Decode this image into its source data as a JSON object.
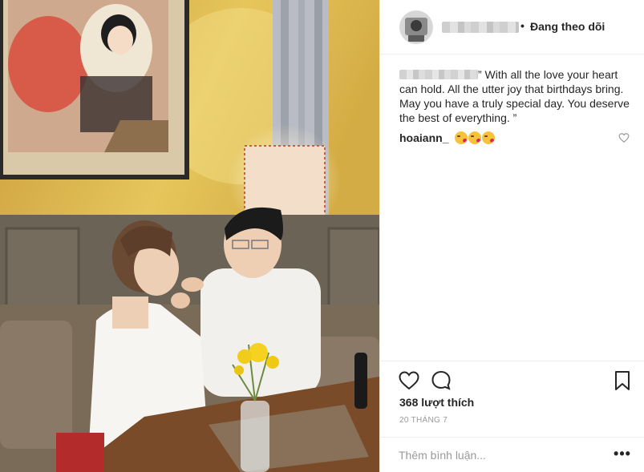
{
  "post": {
    "photo": {
      "description_icon": "photo-couple-dinner"
    },
    "header": {
      "avatar_icon": "avatar-icon",
      "separator": "•",
      "follow_label": "Đang theo dõi"
    },
    "caption": {
      "text": "” With all the love your heart can hold. All the utter joy that birthdays bring. May you have a truly special day. You deserve the best of everything. ”"
    },
    "comment": {
      "username": "hoaiann_",
      "emoji_icon": "kiss-emoji"
    },
    "likes_label": "368 lượt thích",
    "date_label": "20 THÁNG 7",
    "add_comment": {
      "placeholder": "Thêm bình luận...",
      "more_label": "•••"
    }
  },
  "colors": {
    "text": "#262626",
    "muted": "#999999",
    "border": "#efefef",
    "wall": "#d9b14a"
  }
}
